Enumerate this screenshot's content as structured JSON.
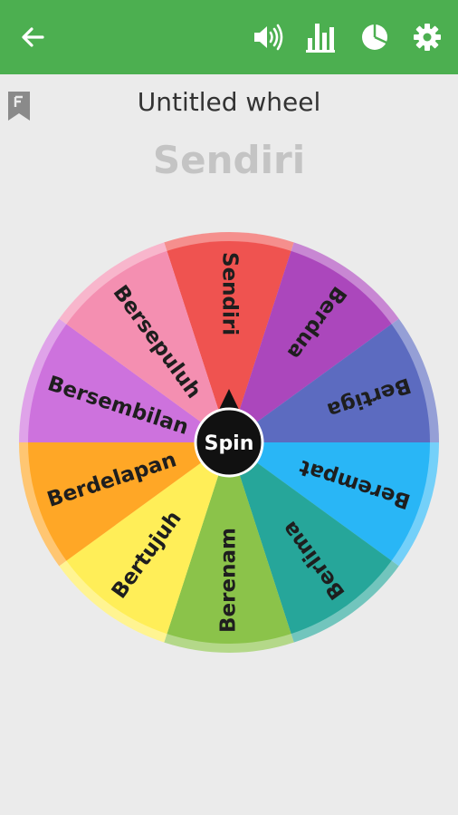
{
  "toolbar": {
    "back_icon": "arrow-left-icon",
    "sound_icon": "volume-icon",
    "stats_icon": "bar-chart-icon",
    "pie_icon": "pie-chart-icon",
    "settings_icon": "gear-icon",
    "background": "#4caf50"
  },
  "wheel_title": "Untitled wheel",
  "result_text": "Sendiri",
  "spin_label": "Spin",
  "segments": [
    {
      "label": "Sendiri",
      "color": "#ef5350"
    },
    {
      "label": "Berdua",
      "color": "#ab47bc"
    },
    {
      "label": "Bertiga",
      "color": "#5c6bc0"
    },
    {
      "label": "Berempat",
      "color": "#29b6f6"
    },
    {
      "label": "Berlima",
      "color": "#26a69a"
    },
    {
      "label": "Berenam",
      "color": "#8bc34a"
    },
    {
      "label": "Bertujuh",
      "color": "#ffee58"
    },
    {
      "label": "Berdelapan",
      "color": "#ffa726"
    },
    {
      "label": "Bersembilan",
      "color": "#cd72dd"
    },
    {
      "label": "Bersepuluh",
      "color": "#f48fb1"
    }
  ]
}
